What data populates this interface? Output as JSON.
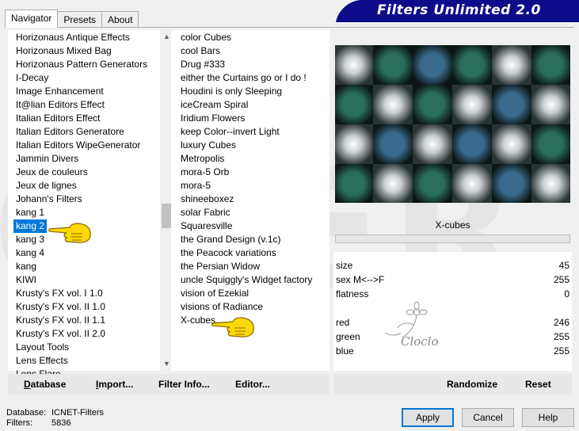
{
  "app": {
    "title": "Filters Unlimited 2.0"
  },
  "tabs": [
    {
      "label": "Navigator",
      "active": true
    },
    {
      "label": "Presets",
      "active": false
    },
    {
      "label": "About",
      "active": false
    }
  ],
  "categories": [
    "Horizonaus Antique Effects",
    "Horizonaus Mixed Bag",
    "Horizonaus Pattern Generators",
    "I-Decay",
    "Image Enhancement",
    "It@lian Editors Effect",
    "Italian Editors Effect",
    "Italian Editors Generatore",
    "Italian Editors WipeGenerator",
    "Jammin Divers",
    "Jeux de couleurs",
    "Jeux de lignes",
    "Johann's Filters",
    "kang 1",
    "kang 2",
    "kang 3",
    "kang 4",
    "kang",
    "KIWI",
    "Krusty's FX vol. I 1.0",
    "Krusty's FX vol. II 1.0",
    "Krusty's FX vol. II 1.1",
    "Krusty's FX vol. II 2.0",
    "Layout Tools",
    "Lens Effects",
    "Lens Flare"
  ],
  "selected_category": "kang 2",
  "filters": [
    "color Cubes",
    "cool Bars",
    "Drug #333",
    "either the Curtains go or I do !",
    "Houdini is only Sleeping",
    "iceCream Spiral",
    "Iridium Flowers",
    "keep Color--invert Light",
    "luxury Cubes",
    "Metropolis",
    "mora-5 Orb",
    "mora-5",
    "shineeboxez",
    "solar Fabric",
    "Squaresville",
    "the Grand Design      (v.1c)",
    "the Peacock variations",
    "the Persian Widow",
    "uncle Squiggly's Widget factory",
    "vision of Ezekial",
    "visions of Radiance",
    "X-cubes"
  ],
  "selected_filter_label": "X-cubes",
  "parameters": [
    {
      "name": "size",
      "value": "45"
    },
    {
      "name": "sex  M<-->F",
      "value": "255"
    },
    {
      "name": "flatness",
      "value": "0"
    },
    {
      "name": "",
      "value": ""
    },
    {
      "name": "red",
      "value": "246"
    },
    {
      "name": "green",
      "value": "255"
    },
    {
      "name": "blue",
      "value": "255"
    }
  ],
  "logo_text": "Cloclo",
  "watermark_text": "OVER",
  "toolbar": {
    "database": "Database",
    "import": "Import...",
    "filter_info": "Filter Info...",
    "editor": "Editor...",
    "randomize": "Randomize",
    "reset": "Reset"
  },
  "status": {
    "database_label": "Database:",
    "database_value": "ICNET-Filters",
    "filters_label": "Filters:",
    "filters_value": "5836"
  },
  "buttons": {
    "apply": "Apply",
    "cancel": "Cancel",
    "help": "Help"
  },
  "colors": {
    "banner": "#0d0d8c",
    "selection": "#0078d7",
    "cube_teal": "#2a6e5c",
    "cube_blue": "#3a6a8c",
    "hand": "#ffd800"
  }
}
